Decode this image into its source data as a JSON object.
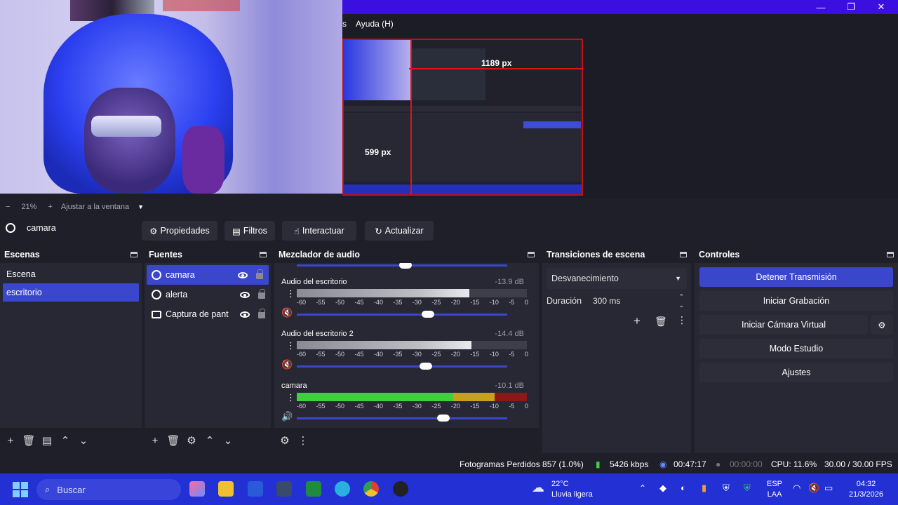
{
  "window": {
    "minimize": "—",
    "maximize": "❐",
    "close": "✕"
  },
  "menubar": {
    "partial_item": "s",
    "help": "Ayuda (H)"
  },
  "preview": {
    "label_width": "1189 px",
    "label_height": "599 px"
  },
  "zoom": {
    "minus": "−",
    "percent": "21%",
    "plus": "+",
    "fit": "Ajustar a la ventana"
  },
  "source_toolbar": {
    "current_source": "camara",
    "properties": "Propiedades",
    "filters": "Filtros",
    "interact": "Interactuar",
    "refresh": "Actualizar"
  },
  "scenes": {
    "title": "Escenas",
    "items": [
      "Escena",
      "escritorio"
    ],
    "selected_index": 1
  },
  "sources": {
    "title": "Fuentes",
    "items": [
      {
        "name": "camara",
        "icon": "globe-icon"
      },
      {
        "name": "alerta",
        "icon": "globe-icon"
      },
      {
        "name": "Captura de pant",
        "icon": "monitor-icon"
      }
    ],
    "selected_index": 0
  },
  "mixer": {
    "title": "Mezclador de audio",
    "scale": [
      "-60",
      "-55",
      "-50",
      "-45",
      "-40",
      "-35",
      "-30",
      "-25",
      "-20",
      "-15",
      "-10",
      "-5",
      "0"
    ],
    "channels": [
      {
        "name": "Audio del escritorio",
        "db": "-13.9 dB",
        "volume": 0.62,
        "muted": true
      },
      {
        "name": "Audio del escritorio 2",
        "db": "-14.4 dB",
        "volume": 0.61,
        "muted": true
      },
      {
        "name": "camara",
        "db": "-10.1 dB",
        "volume": 0.7,
        "muted": false
      }
    ]
  },
  "transitions": {
    "title": "Transiciones de escena",
    "selected": "Desvanecimiento",
    "duration_label": "Duración",
    "duration_value": "300 ms"
  },
  "controls": {
    "title": "Controles",
    "stop_stream": "Detener Transmisión",
    "start_recording": "Iniciar Grabación",
    "virtual_camera": "Iniciar Cámara Virtual",
    "studio_mode": "Modo Estudio",
    "settings": "Ajustes"
  },
  "status": {
    "dropped_frames": "Fotogramas Perdidos 857 (1.0%)",
    "bitrate": "5426 kbps",
    "stream_time": "00:47:17",
    "record_time": "00:00:00",
    "cpu": "CPU: 11.6%",
    "fps": "30.00 / 30.00 FPS"
  },
  "taskbar": {
    "search_placeholder": "Buscar",
    "weather_temp": "22°C",
    "weather_desc": "Lluvia ligera",
    "lang_top": "ESP",
    "lang_bottom": "LAA",
    "time": "04:32",
    "date": "21/3/2026"
  },
  "colors": {
    "accent": "#3a47cc",
    "title_bar": "#3a0fe0",
    "taskbar": "#2230d4",
    "meter_green": "#3fcf3f",
    "meter_yellow": "#c8a020",
    "meter_red": "#8a1a1a"
  }
}
